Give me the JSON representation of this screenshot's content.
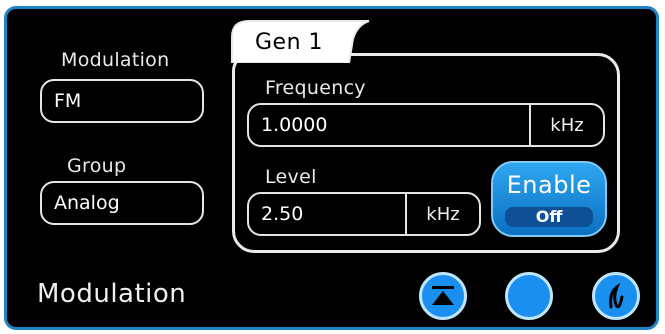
{
  "left": {
    "modulation_label": "Modulation",
    "modulation_value": "FM",
    "group_label": "Group",
    "group_value": "Analog"
  },
  "generator": {
    "tab_title": "Gen 1",
    "frequency_label": "Frequency",
    "frequency_value": "1.0000",
    "frequency_unit": "kHz",
    "level_label": "Level",
    "level_value": "2.50",
    "level_unit": "kHz",
    "enable_label": "Enable",
    "enable_state": "Off"
  },
  "footer": {
    "title": "Modulation",
    "buttons": [
      "eject-icon",
      "blank-circle",
      "modulation-wave-icon"
    ]
  },
  "colors": {
    "frame_border": "#1e86c6",
    "button_blue": "#1a8ff0",
    "background": "#000000",
    "text": "#e9e9e9"
  }
}
